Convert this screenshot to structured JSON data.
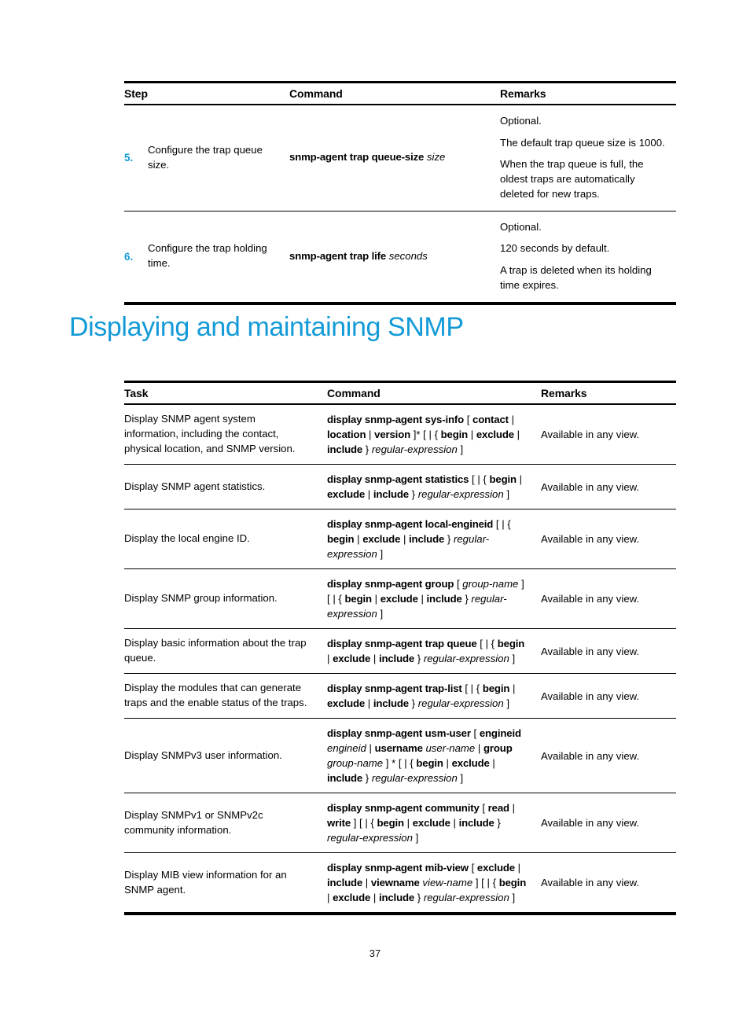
{
  "document": {
    "page_number": "37",
    "accent_color": "#149bd7",
    "text_color": "#000000"
  },
  "section_heading": "Displaying and maintaining SNMP",
  "steps_table": {
    "name": "configuration-steps-table",
    "headers": [
      "Step",
      "Command",
      "Remarks"
    ],
    "rows": [
      {
        "number": "5.",
        "step": "Configure the trap queue size.",
        "command": [
          {
            "text": "snmp-agent trap queue-size",
            "style": "bold"
          },
          {
            "text": "size",
            "style": "italic"
          }
        ],
        "remarks": [
          "Optional.",
          "The default trap queue size is 1000.",
          "When the trap queue is full, the oldest traps are automatically deleted for new traps."
        ]
      },
      {
        "number": "6.",
        "step": "Configure the trap holding time.",
        "command": [
          {
            "text": "snmp-agent trap life",
            "style": "bold"
          },
          {
            "text": "seconds",
            "style": "italic"
          }
        ],
        "remarks": [
          "Optional.",
          "120 seconds by default.",
          "A trap is deleted when its holding time expires."
        ]
      }
    ]
  },
  "display_table": {
    "name": "display-maintain-table",
    "headers": [
      "Task",
      "Command",
      "Remarks"
    ],
    "rows": [
      {
        "task": "Display SNMP agent system information, including the contact, physical location, and SNMP version.",
        "command": [
          {
            "text": "display snmp-agent sys-info",
            "style": "bold"
          },
          {
            "text": "[",
            "style": "plain"
          },
          {
            "text": "contact",
            "style": "bold"
          },
          {
            "text": "|",
            "style": "plain"
          },
          {
            "text": "location",
            "style": "bold"
          },
          {
            "text": "|",
            "style": "plain"
          },
          {
            "text": "version",
            "style": "bold"
          },
          {
            "text": "]* [ | {",
            "style": "plain"
          },
          {
            "text": "begin",
            "style": "bold"
          },
          {
            "text": "|",
            "style": "plain"
          },
          {
            "text": "exclude",
            "style": "bold"
          },
          {
            "text": "|",
            "style": "plain"
          },
          {
            "text": "include",
            "style": "bold"
          },
          {
            "text": "}",
            "style": "plain"
          },
          {
            "text": "regular-expression",
            "style": "italic"
          },
          {
            "text": "]",
            "style": "plain"
          }
        ],
        "remarks": "Available in any view."
      },
      {
        "task": "Display SNMP agent statistics.",
        "command": [
          {
            "text": "display snmp-agent statistics",
            "style": "bold"
          },
          {
            "text": "[ | {",
            "style": "plain"
          },
          {
            "text": "begin",
            "style": "bold"
          },
          {
            "text": "|",
            "style": "plain"
          },
          {
            "text": "exclude",
            "style": "bold"
          },
          {
            "text": "|",
            "style": "plain"
          },
          {
            "text": "include",
            "style": "bold"
          },
          {
            "text": "}",
            "style": "plain"
          },
          {
            "text": "regular-expression",
            "style": "italic"
          },
          {
            "text": "]",
            "style": "plain"
          }
        ],
        "remarks": "Available in any view."
      },
      {
        "task": "Display the local engine ID.",
        "command": [
          {
            "text": "display snmp-agent local-engineid",
            "style": "bold"
          },
          {
            "text": "[ | {",
            "style": "plain"
          },
          {
            "text": "begin",
            "style": "bold"
          },
          {
            "text": "|",
            "style": "plain"
          },
          {
            "text": "exclude",
            "style": "bold"
          },
          {
            "text": "|",
            "style": "plain"
          },
          {
            "text": "include",
            "style": "bold"
          },
          {
            "text": "}",
            "style": "plain"
          },
          {
            "text": "regular-expression",
            "style": "italic"
          },
          {
            "text": "]",
            "style": "plain"
          }
        ],
        "remarks": "Available in any view."
      },
      {
        "task": "Display SNMP group information.",
        "command": [
          {
            "text": "display snmp-agent group",
            "style": "bold"
          },
          {
            "text": "[",
            "style": "plain"
          },
          {
            "text": "group-name",
            "style": "italic"
          },
          {
            "text": "] [ | {",
            "style": "plain"
          },
          {
            "text": "begin",
            "style": "bold"
          },
          {
            "text": "|",
            "style": "plain"
          },
          {
            "text": "exclude",
            "style": "bold"
          },
          {
            "text": "|",
            "style": "plain"
          },
          {
            "text": "include",
            "style": "bold"
          },
          {
            "text": "}",
            "style": "plain"
          },
          {
            "text": "regular-expression",
            "style": "italic"
          },
          {
            "text": "]",
            "style": "plain"
          }
        ],
        "remarks": "Available in any view."
      },
      {
        "task": "Display basic information about the trap queue.",
        "command": [
          {
            "text": "display snmp-agent trap queue",
            "style": "bold"
          },
          {
            "text": "[ | {",
            "style": "plain"
          },
          {
            "text": "begin",
            "style": "bold"
          },
          {
            "text": "|",
            "style": "plain"
          },
          {
            "text": "exclude",
            "style": "bold"
          },
          {
            "text": "|",
            "style": "plain"
          },
          {
            "text": "include",
            "style": "bold"
          },
          {
            "text": "}",
            "style": "plain"
          },
          {
            "text": "regular-expression",
            "style": "italic"
          },
          {
            "text": "]",
            "style": "plain"
          }
        ],
        "remarks": "Available in any view."
      },
      {
        "task": "Display the modules that can generate traps and the enable status of the traps.",
        "command": [
          {
            "text": "display snmp-agent trap-list",
            "style": "bold"
          },
          {
            "text": "[ | {",
            "style": "plain"
          },
          {
            "text": "begin",
            "style": "bold"
          },
          {
            "text": "|",
            "style": "plain"
          },
          {
            "text": "exclude",
            "style": "bold"
          },
          {
            "text": "|",
            "style": "plain"
          },
          {
            "text": "include",
            "style": "bold"
          },
          {
            "text": "}",
            "style": "plain"
          },
          {
            "text": "regular-expression",
            "style": "italic"
          },
          {
            "text": "]",
            "style": "plain"
          }
        ],
        "remarks": "Available in any view."
      },
      {
        "task": "Display SNMPv3 user information.",
        "command": [
          {
            "text": "display snmp-agent usm-user",
            "style": "bold"
          },
          {
            "text": "[",
            "style": "plain"
          },
          {
            "text": "engineid",
            "style": "bold"
          },
          {
            "text": "engineid",
            "style": "italic"
          },
          {
            "text": "|",
            "style": "plain"
          },
          {
            "text": "username",
            "style": "bold"
          },
          {
            "text": "user-name",
            "style": "italic"
          },
          {
            "text": "|",
            "style": "plain"
          },
          {
            "text": "group",
            "style": "bold"
          },
          {
            "text": "group-name",
            "style": "italic"
          },
          {
            "text": "] * [ | {",
            "style": "plain"
          },
          {
            "text": "begin",
            "style": "bold"
          },
          {
            "text": "|",
            "style": "plain"
          },
          {
            "text": "exclude",
            "style": "bold"
          },
          {
            "text": "|",
            "style": "plain"
          },
          {
            "text": "include",
            "style": "bold"
          },
          {
            "text": "}",
            "style": "plain"
          },
          {
            "text": "regular-expression",
            "style": "italic"
          },
          {
            "text": "]",
            "style": "plain"
          }
        ],
        "remarks": "Available in any view."
      },
      {
        "task": "Display SNMPv1 or SNMPv2c community information.",
        "command": [
          {
            "text": "display snmp-agent community",
            "style": "bold"
          },
          {
            "text": "[",
            "style": "plain"
          },
          {
            "text": "read",
            "style": "bold"
          },
          {
            "text": "|",
            "style": "plain"
          },
          {
            "text": "write",
            "style": "bold"
          },
          {
            "text": "] [ | {",
            "style": "plain"
          },
          {
            "text": "begin",
            "style": "bold"
          },
          {
            "text": "|",
            "style": "plain"
          },
          {
            "text": "exclude",
            "style": "bold"
          },
          {
            "text": "|",
            "style": "plain"
          },
          {
            "text": "include",
            "style": "bold"
          },
          {
            "text": "}",
            "style": "plain"
          },
          {
            "text": "regular-expression",
            "style": "italic"
          },
          {
            "text": "]",
            "style": "plain"
          }
        ],
        "remarks": "Available in any view."
      },
      {
        "task": "Display MIB view information for an SNMP agent.",
        "command": [
          {
            "text": "display snmp-agent mib-view",
            "style": "bold"
          },
          {
            "text": "[",
            "style": "plain"
          },
          {
            "text": "exclude",
            "style": "bold"
          },
          {
            "text": "|",
            "style": "plain"
          },
          {
            "text": "include",
            "style": "bold"
          },
          {
            "text": "|",
            "style": "plain"
          },
          {
            "text": "viewname",
            "style": "bold"
          },
          {
            "text": "view-name",
            "style": "italic"
          },
          {
            "text": "] [ | {",
            "style": "plain"
          },
          {
            "text": "begin",
            "style": "bold"
          },
          {
            "text": "|",
            "style": "plain"
          },
          {
            "text": "exclude",
            "style": "bold"
          },
          {
            "text": "|",
            "style": "plain"
          },
          {
            "text": "include",
            "style": "bold"
          },
          {
            "text": "}",
            "style": "plain"
          },
          {
            "text": "regular-expression",
            "style": "italic"
          },
          {
            "text": "]",
            "style": "plain"
          }
        ],
        "remarks": "Available in any view."
      }
    ]
  }
}
